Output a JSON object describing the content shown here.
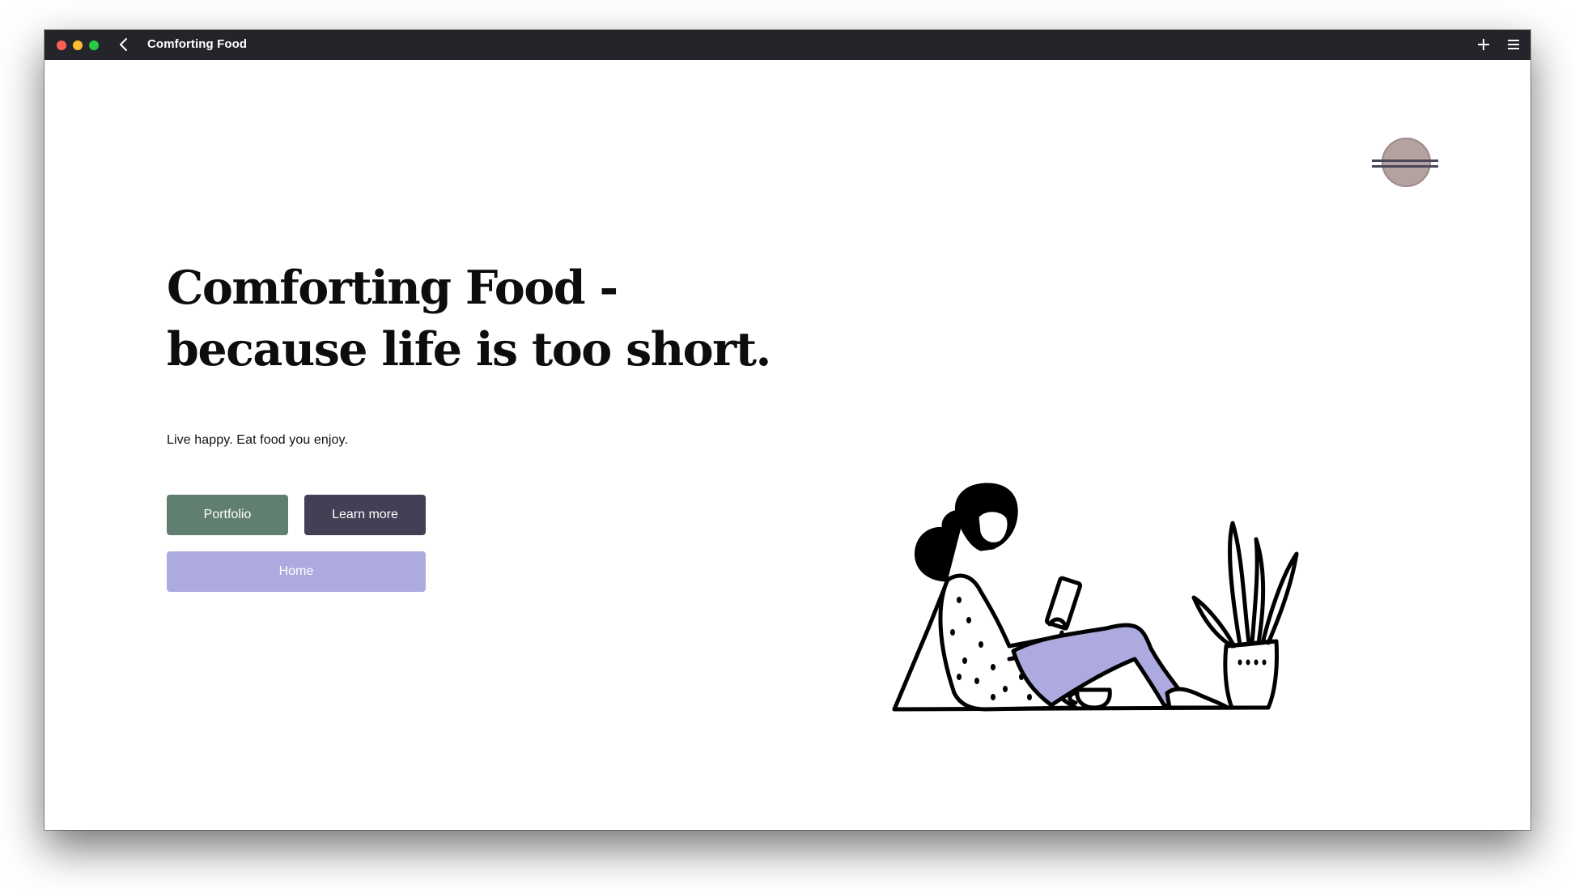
{
  "window": {
    "title": "Comforting Food",
    "icons": [
      "back-icon",
      "plus-icon",
      "menu-icon"
    ]
  },
  "hero": {
    "headline_line1": "Comforting Food -",
    "headline_line2": "because life is too short.",
    "tagline": "Live happy. Eat food you enjoy."
  },
  "buttons": {
    "portfolio": "Portfolio",
    "learn_more": "Learn more",
    "home": "Home"
  },
  "colors": {
    "titlebar": "#23252b",
    "portfolio_button": "#607f71",
    "learn_more_button": "#453f55",
    "home_button": "#adaadf",
    "burger_disc": "#b3a2a0",
    "accent_lavender": "#adaadf"
  },
  "illustration": {
    "subject": "woman-reading-phone-with-plant-icon"
  }
}
